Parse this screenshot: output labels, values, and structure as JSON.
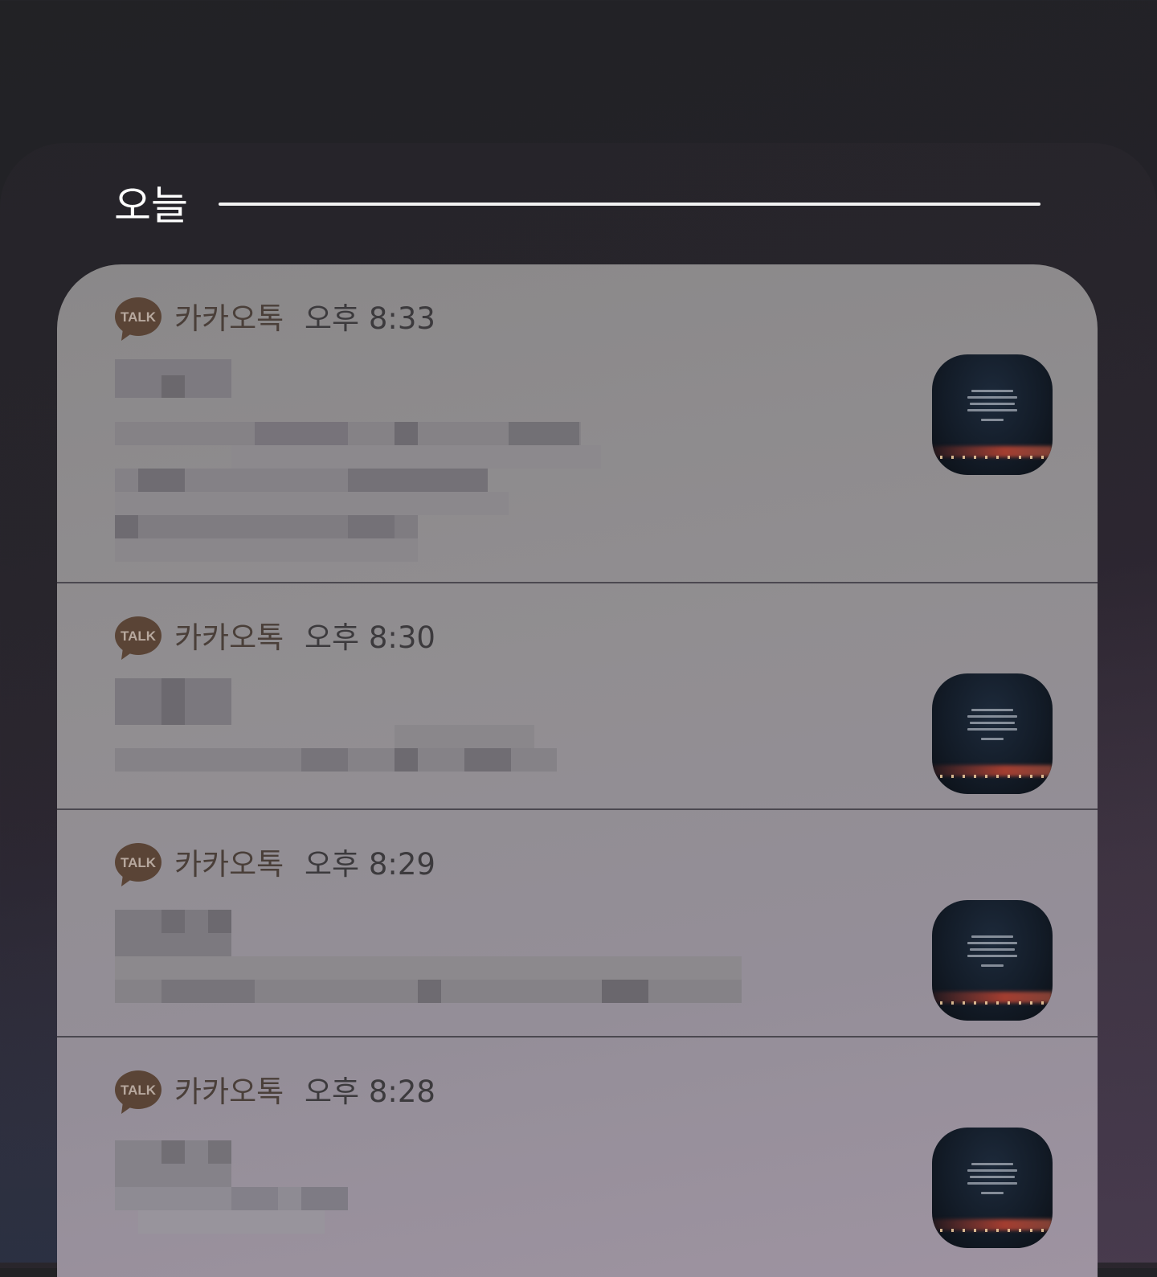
{
  "section": {
    "title": "오늘"
  },
  "notifications": [
    {
      "app_icon": "kakaotalk-talk-icon",
      "icon_label": "TALK",
      "app_name": "카카오톡",
      "time": "오후 8:33",
      "message": "",
      "thumbnail": "chat-profile-image"
    },
    {
      "app_icon": "kakaotalk-talk-icon",
      "icon_label": "TALK",
      "app_name": "카카오톡",
      "time": "오후 8:30",
      "message": "",
      "thumbnail": "chat-profile-image"
    },
    {
      "app_icon": "kakaotalk-talk-icon",
      "icon_label": "TALK",
      "app_name": "카카오톡",
      "time": "오후 8:29",
      "message": "",
      "thumbnail": "chat-profile-image"
    },
    {
      "app_icon": "kakaotalk-talk-icon",
      "icon_label": "TALK",
      "app_name": "카카오톡",
      "time": "오후 8:28",
      "message": "",
      "thumbnail": "chat-profile-image"
    }
  ],
  "colors": {
    "kakao_brown": "#5a4436",
    "card_bg": "#918e91",
    "divider": "#4b4850"
  }
}
